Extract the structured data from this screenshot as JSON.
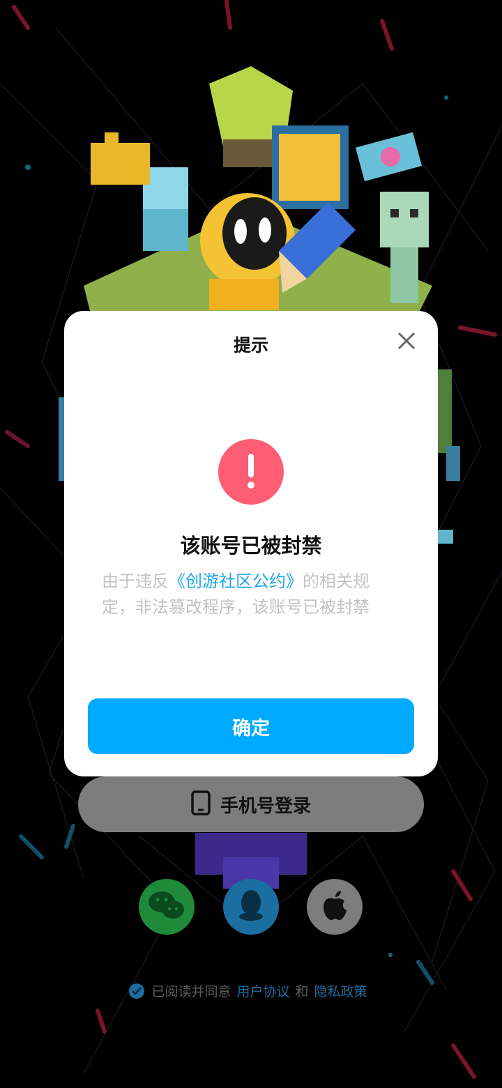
{
  "dialog": {
    "title": "提示",
    "headline": "该账号已被封禁",
    "message_prefix": "由于违反",
    "message_rule": "《创游社区公约》",
    "message_suffix": "的相关规定，非法篡改程序，该账号已被封禁",
    "confirm_label": "确定",
    "alert_color": "#ff5d73",
    "accent_color": "#00aaff"
  },
  "login": {
    "phone_label": "手机号登录",
    "social": [
      {
        "name": "wechat-icon",
        "color": "#1f8a3a"
      },
      {
        "name": "qq-icon",
        "color": "#1a6fa0"
      },
      {
        "name": "apple-icon",
        "color": "#7d7d7d"
      }
    ],
    "agreement_prefix": "已阅读并同意",
    "user_agreement": "用户协议",
    "and": "和",
    "privacy_policy": "隐私政策"
  }
}
